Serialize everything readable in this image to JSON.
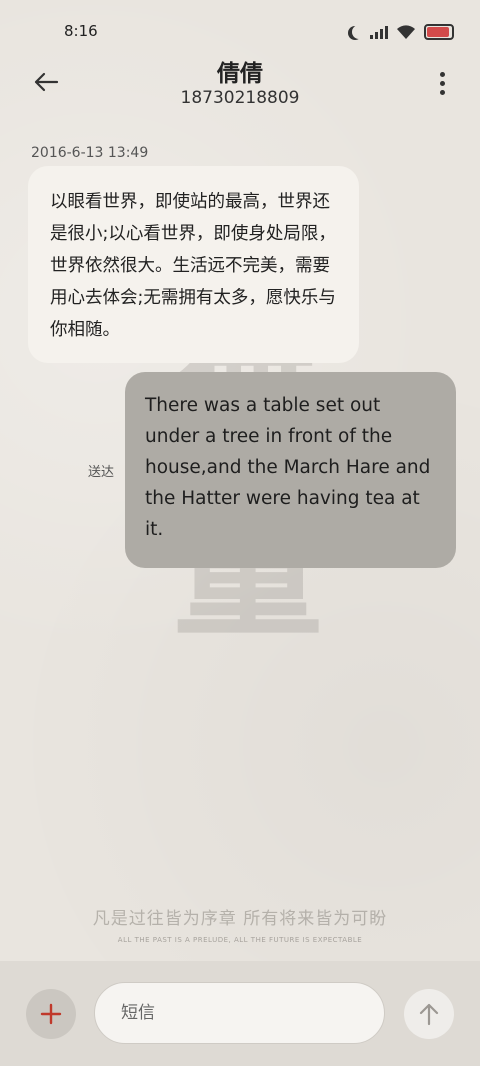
{
  "status_bar": {
    "time": "8:16",
    "icons": [
      "moon-icon",
      "signal-icon",
      "wifi-icon",
      "battery-icon"
    ],
    "battery_color": "#d24a4a"
  },
  "header": {
    "contact_name": "倩倩",
    "phone_number": "18730218809",
    "back_icon": "arrow-left-icon",
    "menu_icon": "more-vertical-icon"
  },
  "background": {
    "calligraphy_chars": [
      "無",
      "量"
    ],
    "motto": "凡是过往皆为序章 所有将来皆为可盼",
    "motto_en": "ALL THE PAST IS A PRELUDE, ALL THE FUTURE IS EXPECTABLE"
  },
  "messages": [
    {
      "direction": "incoming",
      "timestamp": "2016-6-13 13:49",
      "text": "以眼看世界，即使站的最高，世界还是很小;以心看世界，即使身处局限，世界依然很大。生活远不完美，需要用心去体会;无需拥有太多，愿快乐与你相随。"
    },
    {
      "direction": "outgoing",
      "status": "送达",
      "text": "There was a table set out under a tree in front of the house,and the March Hare and the Hatter were having tea at it."
    }
  ],
  "composer": {
    "placeholder": "短信",
    "add_icon": "plus-icon",
    "send_icon": "arrow-up-icon",
    "accent_color": "#c0392b"
  }
}
